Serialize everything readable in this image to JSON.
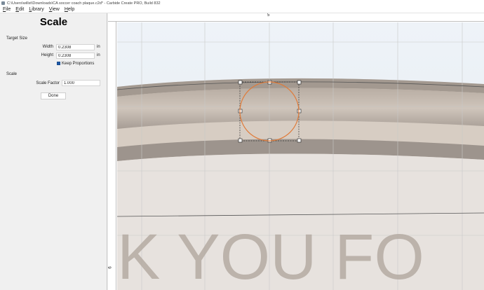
{
  "window": {
    "title": "C:\\Users\\willst\\Downloads\\CA soccer coach plaque.c2d* - Carbide Create PRO, Build 832"
  },
  "menu": [
    "File",
    "Edit",
    "Library",
    "View",
    "Help"
  ],
  "panel": {
    "title": "Scale",
    "target_size_label": "Target Size",
    "width_label": "Width",
    "width_value": "0.2308",
    "height_label": "Height",
    "height_value": "0.2308",
    "unit": "in",
    "keep_proportions_label": "Keep Proportions",
    "keep_proportions_checked": true,
    "scale_section_label": "Scale",
    "scale_factor_label": "Scale Factor",
    "scale_factor_value": "1.000",
    "done_label": "Done"
  },
  "rulers": {
    "top_label": "5",
    "left_label": "6"
  },
  "canvas": {
    "background_text": "K YOU FO",
    "selected_shape": "circle",
    "circle_color": "#e07b39"
  },
  "colors": {
    "checkbox": "#1e5aa8",
    "grid": "#c8c8c8"
  }
}
